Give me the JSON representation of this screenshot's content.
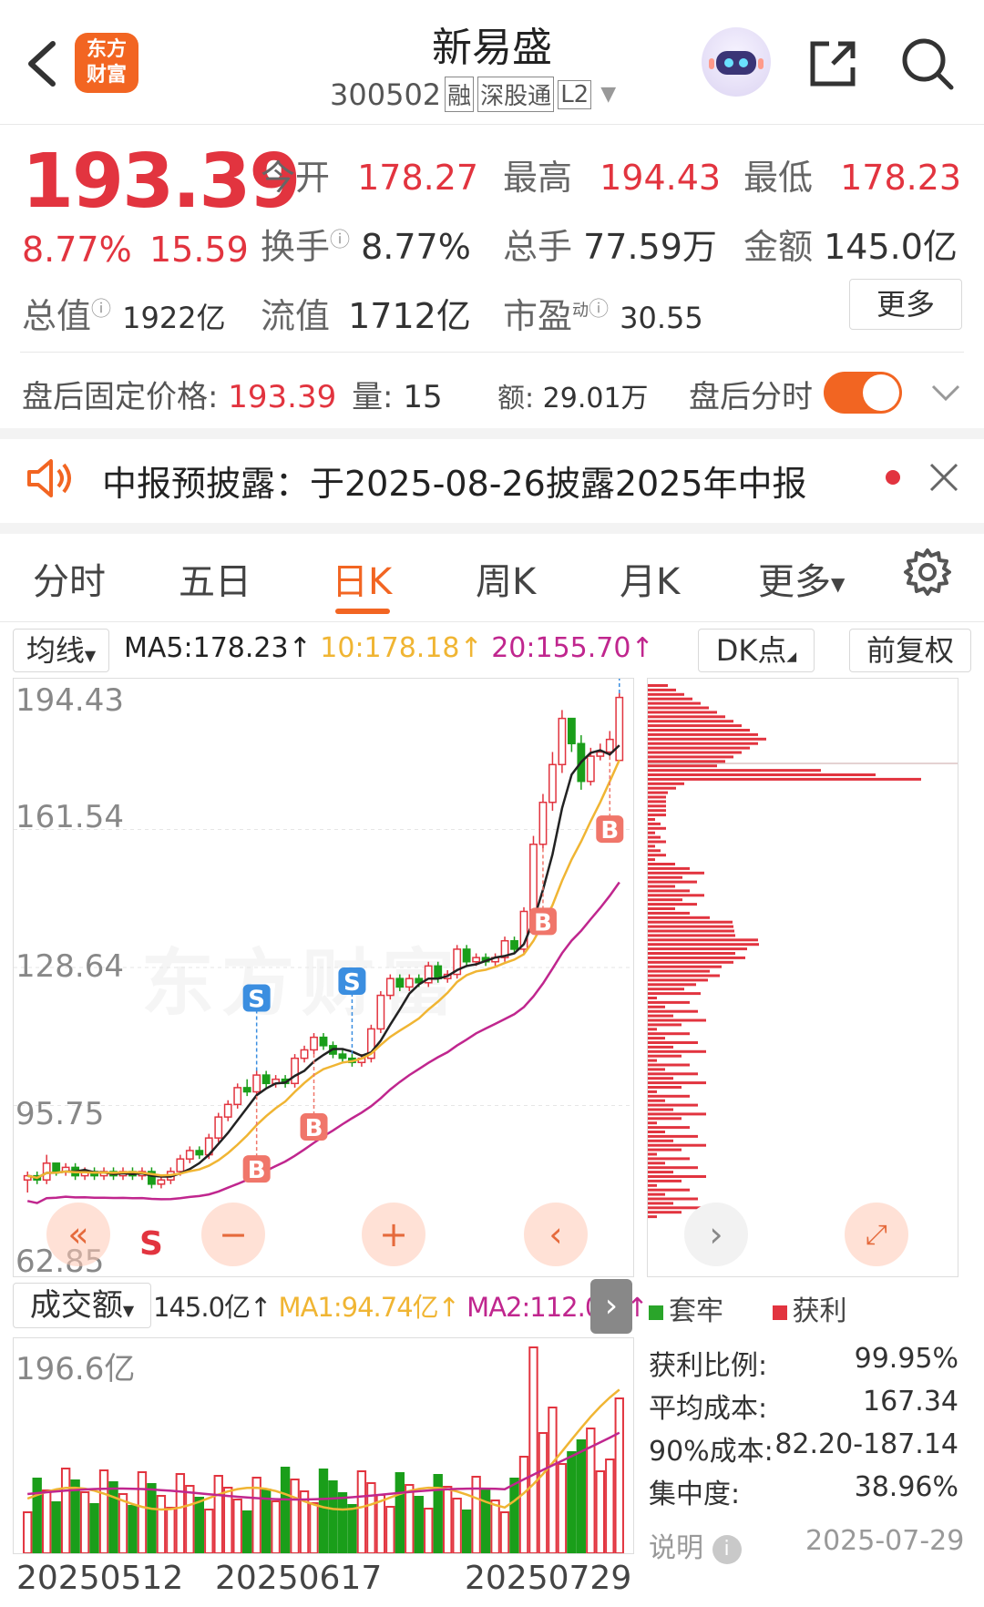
{
  "header": {
    "logo_text": "东方财富",
    "title": "新易盛",
    "code": "300502",
    "badges": [
      "融",
      "深股通",
      "L2"
    ]
  },
  "quote": {
    "price": "193.39",
    "change_pct": "8.77%",
    "change": "15.59",
    "open_label": "今开",
    "open": "178.27",
    "high_label": "最高",
    "high": "194.43",
    "low_label": "最低",
    "low": "178.23",
    "turnover_label": "换手",
    "turnover": "8.77%",
    "volume_label": "总手",
    "volume": "77.59万",
    "amount_label": "金额",
    "amount": "145.0亿",
    "mcap_label": "总值",
    "mcap": "1922亿",
    "float_label": "流值",
    "float": "1712亿",
    "pe_label": "市盈",
    "pe_sup": "动",
    "pe": "30.55",
    "more_button": "更多"
  },
  "after_hours": {
    "label": "盘后固定价格:",
    "price": "193.39",
    "vol_label": "量:",
    "vol": "15",
    "amt_label": "额:",
    "amt": "29.01万",
    "toggle_label": "盘后分时",
    "toggle_on": true
  },
  "notice": {
    "text": "中报预披露：于2025-08-26披露2025年中报"
  },
  "tabs": {
    "items": [
      "分时",
      "五日",
      "日K",
      "周K",
      "月K",
      "更多"
    ],
    "active": "日K"
  },
  "indicator_bar": {
    "ma_select": "均线",
    "ma5": "MA5:178.23↑",
    "ma10": "10:178.18↑",
    "ma20": "20:155.70↑",
    "dk_button": "DK点",
    "adjust_button": "前复权"
  },
  "kline": {
    "y_labels": [
      "194.43",
      "161.54",
      "128.64",
      "95.75",
      "62.85"
    ],
    "watermark": "东方财富",
    "markers": {
      "buy": "B",
      "sell": "S"
    },
    "colors": {
      "up": "#e2343f",
      "down": "#1a9e1a",
      "ma5": "#222222",
      "ma10": "#f0b533",
      "ma20": "#c0268e"
    }
  },
  "chart_data": [
    {
      "type": "candlestick",
      "title": "",
      "ylim": [
        62.85,
        194.43
      ],
      "y_ticks": [
        194.43,
        161.54,
        128.64,
        95.75,
        62.85
      ],
      "series": [
        {
          "name": "MA5",
          "value": "178.23"
        },
        {
          "name": "10",
          "value": "178.18"
        },
        {
          "name": "20",
          "value": "155.70"
        }
      ],
      "candles": [
        [
          78,
          79,
          75,
          80
        ],
        [
          79,
          78,
          77,
          80
        ],
        [
          78,
          82,
          77,
          84
        ],
        [
          82,
          80,
          79,
          82
        ],
        [
          80,
          81,
          79,
          82
        ],
        [
          81,
          79,
          78,
          82
        ],
        [
          79,
          80,
          78,
          81
        ],
        [
          80,
          79,
          78,
          81
        ],
        [
          79,
          80,
          78,
          81
        ],
        [
          80,
          79,
          78,
          81
        ],
        [
          79,
          80,
          78,
          81
        ],
        [
          80,
          79,
          78,
          81
        ],
        [
          79,
          80,
          78,
          81
        ],
        [
          80,
          77,
          76,
          81
        ],
        [
          77,
          78,
          76,
          79
        ],
        [
          78,
          80,
          77,
          81
        ],
        [
          80,
          83,
          79,
          84
        ],
        [
          83,
          85,
          82,
          86
        ],
        [
          85,
          84,
          83,
          86
        ],
        [
          84,
          88,
          83,
          89
        ],
        [
          88,
          93,
          87,
          94
        ],
        [
          93,
          96,
          92,
          97
        ],
        [
          96,
          100,
          95,
          101
        ],
        [
          100,
          99,
          98,
          102
        ],
        [
          99,
          103,
          98,
          104
        ],
        [
          103,
          101,
          100,
          104
        ],
        [
          101,
          102,
          100,
          103
        ],
        [
          102,
          101,
          100,
          103
        ],
        [
          101,
          107,
          100,
          108
        ],
        [
          107,
          109,
          106,
          110
        ],
        [
          109,
          112,
          108,
          113
        ],
        [
          112,
          110,
          109,
          113
        ],
        [
          110,
          108,
          107,
          111
        ],
        [
          108,
          107,
          106,
          109
        ],
        [
          107,
          106,
          105,
          108
        ],
        [
          106,
          107,
          105,
          108
        ],
        [
          107,
          114,
          106,
          115
        ],
        [
          114,
          122,
          113,
          123
        ],
        [
          122,
          126,
          121,
          127
        ],
        [
          126,
          124,
          123,
          127
        ],
        [
          124,
          126,
          123,
          127
        ],
        [
          126,
          125,
          124,
          127
        ],
        [
          125,
          129,
          124,
          130
        ],
        [
          129,
          126,
          125,
          130
        ],
        [
          126,
          127,
          125,
          128
        ],
        [
          127,
          133,
          126,
          134
        ],
        [
          133,
          130,
          129,
          134
        ],
        [
          130,
          131,
          129,
          132
        ],
        [
          131,
          130,
          129,
          132
        ],
        [
          130,
          131,
          129,
          132
        ],
        [
          131,
          135,
          130,
          136
        ],
        [
          135,
          133,
          132,
          136
        ],
        [
          133,
          142,
          132,
          143
        ],
        [
          142,
          158,
          141,
          160
        ],
        [
          158,
          168,
          157,
          170
        ],
        [
          168,
          177,
          166,
          180
        ],
        [
          177,
          188,
          175,
          190
        ],
        [
          188,
          182,
          180,
          186
        ],
        [
          182,
          173,
          171,
          184
        ],
        [
          173,
          179,
          172,
          181
        ],
        [
          179,
          180,
          178,
          182
        ],
        [
          180,
          183,
          179,
          185
        ],
        [
          178,
          193,
          178,
          194
        ]
      ]
    },
    {
      "type": "bar",
      "title": "",
      "label": "成交额",
      "values_text": [
        "145.0亿",
        "MA1:94.74亿↑",
        "MA2:112.0亿↑"
      ],
      "ymax_label": "196.6亿",
      "x_labels": [
        "20250512",
        "20250617",
        "20250729"
      ]
    }
  ],
  "chip": {
    "legend_trap": "套牢",
    "legend_profit": "获利",
    "stats": [
      {
        "label": "获利比例:",
        "value": "99.95%"
      },
      {
        "label": "平均成本:",
        "value": "167.34"
      },
      {
        "label": "90%成本:",
        "value": "82.20-187.14"
      },
      {
        "label": "集中度:",
        "value": "38.96%"
      }
    ],
    "note_label": "说明",
    "date": "2025-07-29"
  },
  "volume": {
    "select": "成交额",
    "value": "145.0亿↑",
    "ma1": "MA1:94.74亿↑",
    "ma2": "MA2:112.0亿↑",
    "max_label": "196.6亿",
    "dates": [
      "20250512",
      "20250617",
      "20250729"
    ]
  }
}
